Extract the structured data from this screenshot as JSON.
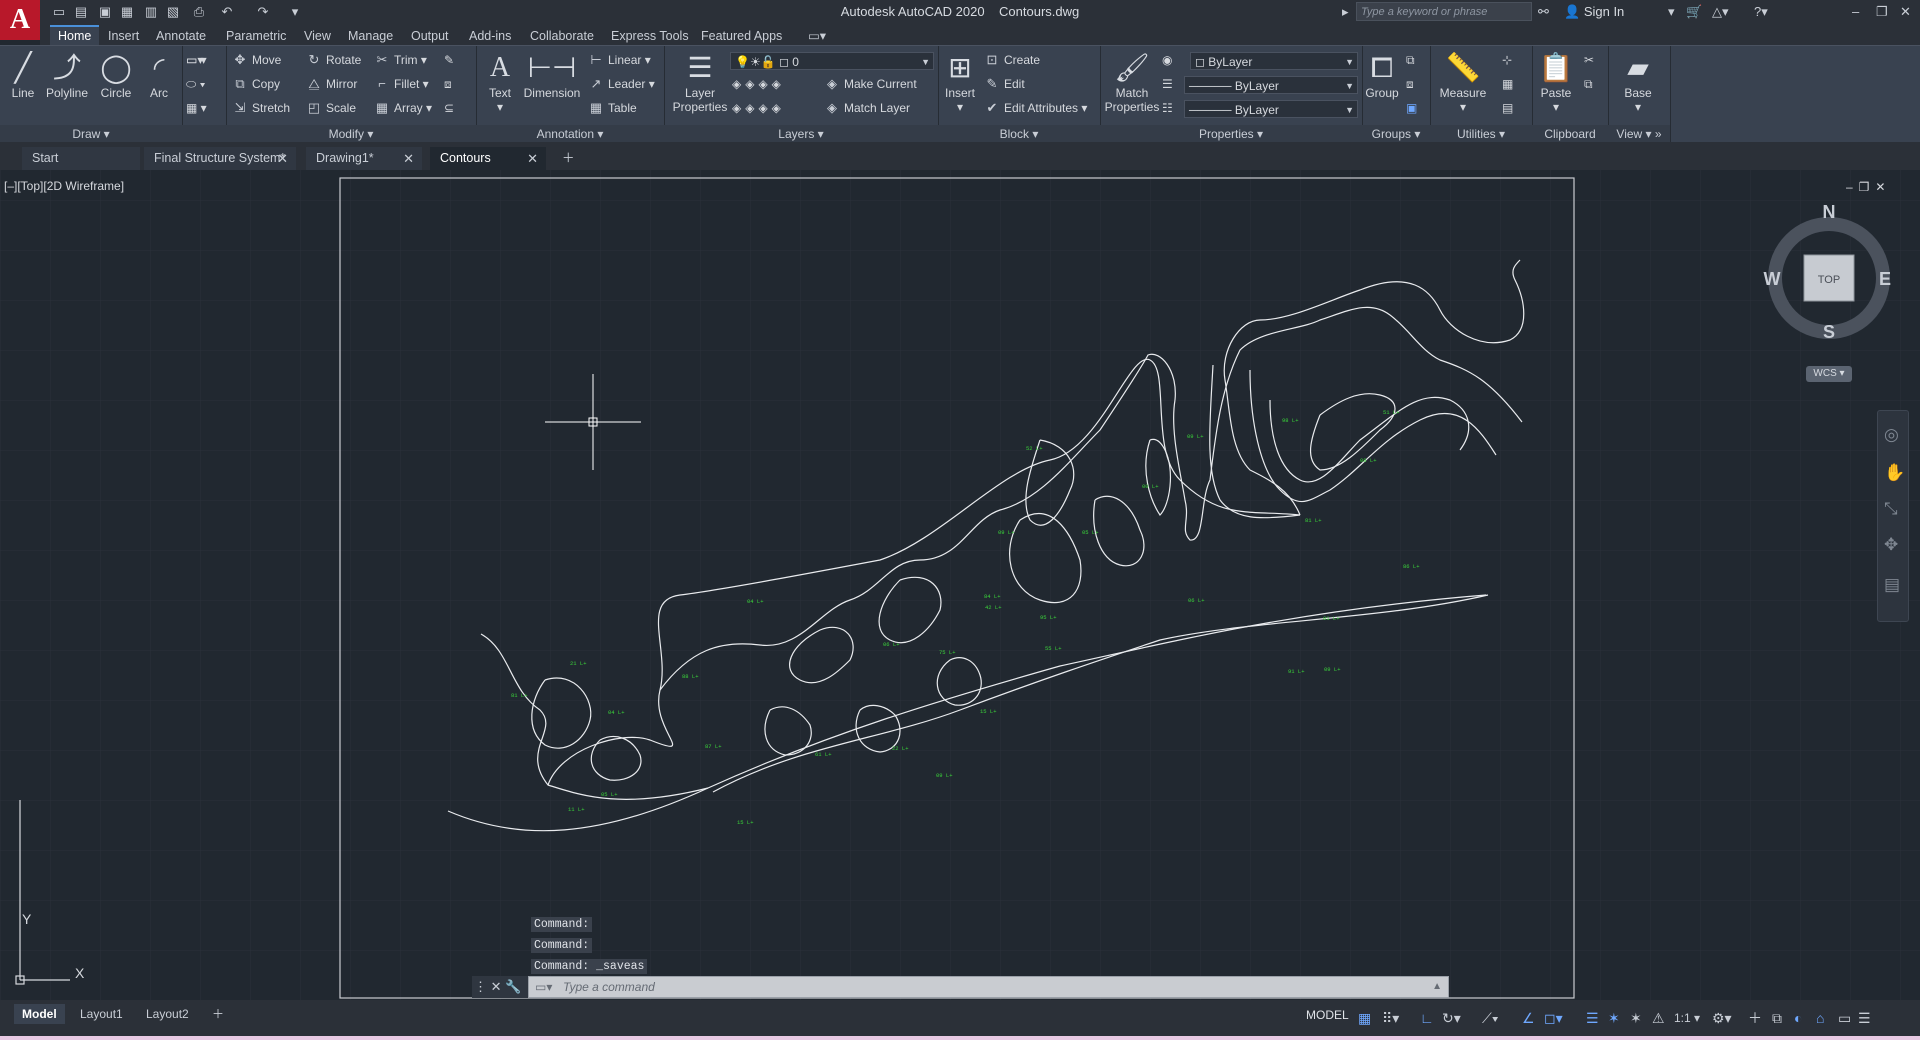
{
  "app": {
    "logo": "A",
    "title": "Autodesk AutoCAD 2020",
    "file": "Contours.dwg",
    "search_placeholder": "Type a keyword or phrase",
    "sign_in": "Sign In"
  },
  "ribbon_tabs": [
    "Home",
    "Insert",
    "Annotate",
    "Parametric",
    "View",
    "Manage",
    "Output",
    "Add-ins",
    "Collaborate",
    "Express Tools",
    "Featured Apps"
  ],
  "ribbon": {
    "draw": {
      "title": "Draw",
      "line": "Line",
      "polyline": "Polyline",
      "circle": "Circle",
      "arc": "Arc"
    },
    "modify": {
      "title": "Modify",
      "move": "Move",
      "rotate": "Rotate",
      "trim": "Trim",
      "copy": "Copy",
      "mirror": "Mirror",
      "fillet": "Fillet",
      "stretch": "Stretch",
      "scale": "Scale",
      "array": "Array"
    },
    "annotation": {
      "title": "Annotation",
      "text": "Text",
      "dimension": "Dimension",
      "linear": "Linear",
      "leader": "Leader",
      "table": "Table"
    },
    "layers": {
      "title": "Layers",
      "layer_properties_1": "Layer",
      "layer_properties_2": "Properties",
      "current_layer": "0",
      "make_current": "Make Current",
      "match_layer": "Match Layer"
    },
    "block": {
      "title": "Block",
      "insert": "Insert",
      "create": "Create",
      "edit": "Edit",
      "edit_attributes": "Edit Attributes"
    },
    "properties": {
      "title": "Properties",
      "match_properties_1": "Match",
      "match_properties_2": "Properties",
      "color": "ByLayer",
      "linetype": "ByLayer",
      "lineweight": "ByLayer"
    },
    "groups": {
      "title": "Groups",
      "group": "Group"
    },
    "utilities": {
      "title": "Utilities",
      "measure": "Measure"
    },
    "clipboard": {
      "title": "Clipboard",
      "paste": "Paste"
    },
    "view": {
      "title": "View",
      "base": "Base"
    }
  },
  "doc_tabs": [
    "Start",
    "Final Structure System*",
    "Drawing1*",
    "Contours"
  ],
  "viewport": {
    "label": "[–][Top][2D Wireframe]",
    "compass": {
      "n": "N",
      "s": "S",
      "e": "E",
      "w": "W",
      "top": "TOP"
    },
    "wcs": "WCS",
    "ucs_x": "X",
    "ucs_y": "Y"
  },
  "contour_labels": [
    "52 L+",
    "09 L+",
    "98 L+",
    "51 L+",
    "08 L+",
    "00 L+",
    "05 L+",
    "09 L+",
    "81 L+",
    "86 L+",
    "06 L+",
    "01 L+",
    "91 L+",
    "84 L+",
    "04 L+",
    "42 L+",
    "95 L+",
    "06 L+",
    "75 L+",
    "88 L+",
    "21 L+",
    "04 L+",
    "87 L+",
    "05 L+",
    "61 L+",
    "15 L+",
    "81 L+",
    "11 L+",
    "15 L+",
    "09 L+",
    "55 L+",
    "22 L+",
    "09 L+"
  ],
  "command": {
    "history": [
      "Command:",
      "Command:",
      "Command: _saveas"
    ],
    "placeholder": "Type a command"
  },
  "layout_tabs": [
    "Model",
    "Layout1",
    "Layout2"
  ],
  "status": {
    "model": "MODEL",
    "scale": "1:1"
  }
}
